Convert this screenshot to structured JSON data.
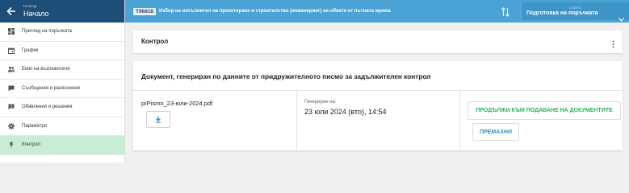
{
  "sidebar": {
    "back_sub": "НАЗАД",
    "back_main": "Начало",
    "items": [
      {
        "label": "Преглед на поръчката",
        "icon": "dashboard-icon"
      },
      {
        "label": "График",
        "icon": "calendar-icon"
      },
      {
        "label": "Екип на възложителя",
        "icon": "team-icon"
      },
      {
        "label": "Съобщения и разяснения",
        "icon": "chat-icon"
      },
      {
        "label": "Обявления и решения",
        "icon": "announcement-icon"
      },
      {
        "label": "Параметри",
        "icon": "gear-icon"
      },
      {
        "label": "Контрол",
        "icon": "pin-icon",
        "active": true
      }
    ]
  },
  "topbar": {
    "badge": "T96818",
    "title": "Избор на изпълнител на проектиране и строителство (инженеринг) на обекти от пътната мрежа",
    "status_label": "СТАТУС",
    "status_value": "Подготовка на поръчката"
  },
  "section": {
    "title": "Контрол"
  },
  "document": {
    "heading": "Документ, генериран по данните от придружителното писмо за задължителен контрол",
    "filename": "prPismo_23-юли-2024.pdf",
    "generated_label": "Генериран на:",
    "generated_value": "23 юли 2024 (вто), 14:54",
    "continue_label": "ПРОДЪЛЖИ КЪМ ПОДАВАНЕ НА ДОКУМЕНТИТЕ",
    "remove_label": "ПРЕМАХНИ"
  },
  "colors": {
    "header_dark": "#1d4e78",
    "topbar": "#4aa3d4",
    "active_nav": "#c8ecd4",
    "accent_green": "#2fb35a",
    "accent_blue": "#3a8fc4"
  }
}
